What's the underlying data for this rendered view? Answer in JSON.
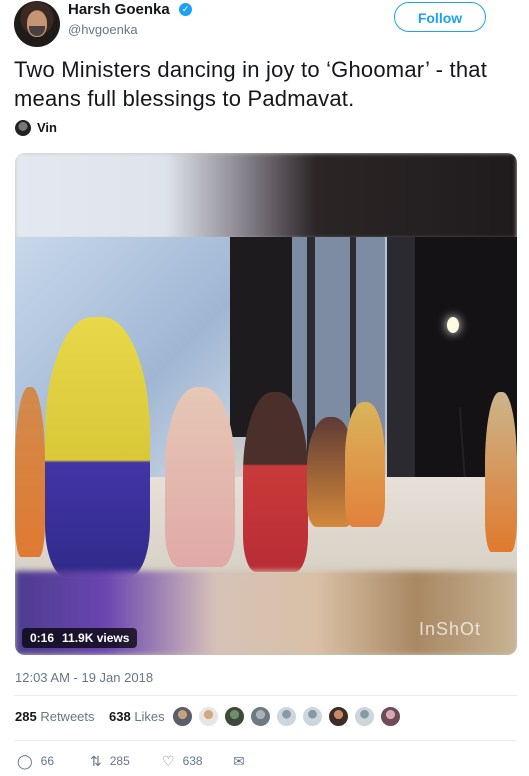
{
  "author": {
    "name": "Harsh Goenka",
    "handle": "@hvgoenka",
    "verified_icon": "verified-badge-icon"
  },
  "follow_button": {
    "label": "Follow"
  },
  "tweet": {
    "text": "Two Ministers dancing in joy to ‘Ghoomar’ - that means full blessings to Padmavat.",
    "quoted_user": "Vin",
    "timestamp": "12:03 AM - 19 Jan 2018"
  },
  "video": {
    "duration": "0:16",
    "views": "11.9K views",
    "watermark": "InShOt"
  },
  "engagement": {
    "retweets_count": "285",
    "retweets_label": "Retweets",
    "likes_count": "638",
    "likes_label": "Likes"
  },
  "actions": {
    "reply_count": "66",
    "retweet_count": "285",
    "like_count": "638"
  },
  "colors": {
    "accent": "#1da1f2",
    "text": "#14171a",
    "muted": "#657786"
  }
}
